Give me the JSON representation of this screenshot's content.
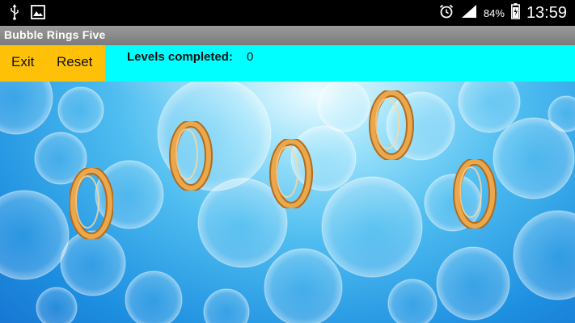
{
  "status_bar": {
    "battery": "84%",
    "time": "13:59",
    "icons": [
      "usb-icon",
      "image-icon",
      "alarm-icon",
      "signal-icon",
      "battery-icon"
    ]
  },
  "app": {
    "title": "Bubble Rings Five"
  },
  "toolbar": {
    "exit_label": "Exit",
    "reset_label": "Reset",
    "levels_label": "Levels completed:",
    "levels_value": "0"
  },
  "game": {
    "ring_count": 5,
    "colors": {
      "ring_gold": "#e8a84a",
      "toolbar_bg": "#00ffff",
      "buttons_bg": "#ffc107",
      "water_blue": "#1d8fe0"
    }
  }
}
